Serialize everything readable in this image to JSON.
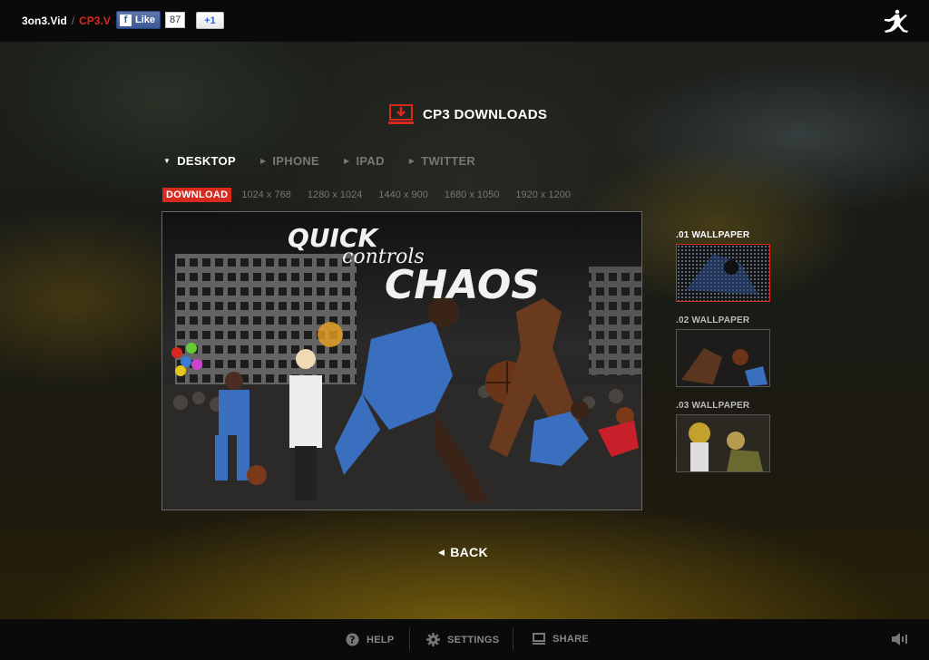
{
  "topbar": {
    "brand": "3on3.Vid",
    "separator": "/",
    "current": "CP3.V",
    "like_label": "Like",
    "like_count": "87",
    "gplus_label": "+1"
  },
  "heading": {
    "title": "CP3 DOWNLOADS"
  },
  "tabs": [
    {
      "label": "DESKTOP",
      "active": true
    },
    {
      "label": "IPHONE",
      "active": false
    },
    {
      "label": "IPAD",
      "active": false
    },
    {
      "label": "TWITTER",
      "active": false
    }
  ],
  "download_label": "DOWNLOAD",
  "resolutions": [
    "1024 x 768",
    "1280 x 1024",
    "1440 x 900",
    "1680 x 1050",
    "1920 x 1200"
  ],
  "preview": {
    "line1": "QUICK",
    "line2": "controls",
    "line3": "CHAOS"
  },
  "wallpapers": [
    {
      "label": ".01 WALLPAPER",
      "selected": true
    },
    {
      "label": ".02 WALLPAPER",
      "selected": false
    },
    {
      "label": ".03 WALLPAPER",
      "selected": false
    }
  ],
  "back_label": "BACK",
  "bottombar": {
    "help": "HELP",
    "settings": "SETTINGS",
    "share": "SHARE"
  },
  "colors": {
    "accent": "#d8291e",
    "bar": "#0a0a0a"
  }
}
